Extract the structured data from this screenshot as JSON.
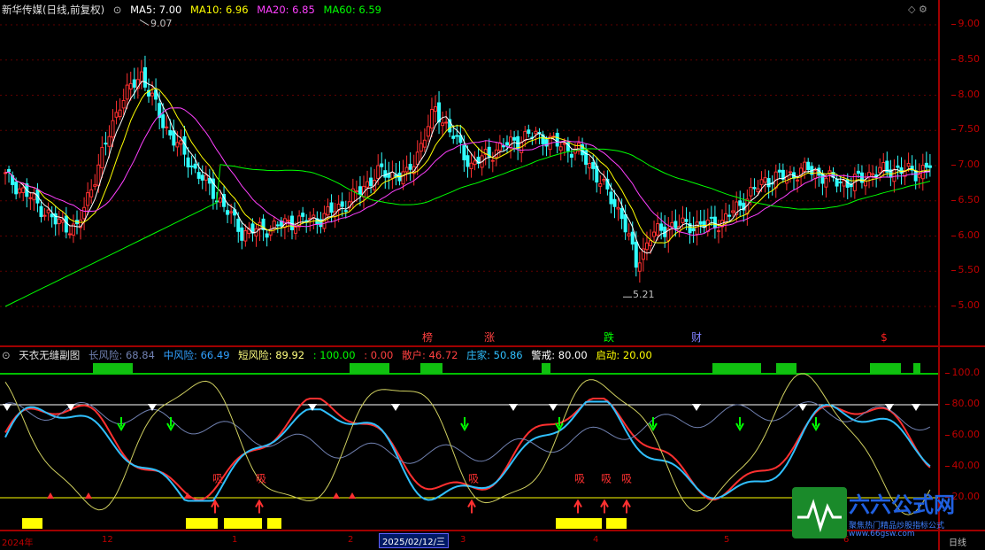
{
  "main": {
    "title": "新华传媒(日线,前复权)",
    "ma": [
      {
        "label": "MA5: 7.00",
        "color": "#ffffff"
      },
      {
        "label": "MA10: 6.96",
        "color": "#ffff00"
      },
      {
        "label": "MA20: 6.85",
        "color": "#ff40ff"
      },
      {
        "label": "MA60: 6.59",
        "color": "#00ff00"
      }
    ],
    "axis_ticks": [
      "9.00",
      "8.50",
      "8.00",
      "7.50",
      "7.00",
      "6.50",
      "6.00",
      "5.50",
      "5.00"
    ],
    "high_label": "9.07",
    "low_label": "5.21",
    "events": [
      {
        "text": "榜",
        "color": "#ff4040"
      },
      {
        "text": "涨",
        "color": "#ff4040"
      },
      {
        "text": "跌",
        "color": "#00ff00"
      },
      {
        "text": "财",
        "color": "#8080ff"
      },
      {
        "text": "$",
        "color": "#ff2020"
      }
    ]
  },
  "sub": {
    "title": "天衣无缝副图",
    "items": [
      {
        "label": "长风险: 68.84",
        "color": "#7080b0"
      },
      {
        "label": "中风险: 66.49",
        "color": "#30a0ff"
      },
      {
        "label": "短风险: 89.92",
        "color": "#ffff80"
      },
      {
        "label": ": 100.00",
        "color": "#00ff00"
      },
      {
        "label": ": 0.00",
        "color": "#ff4040"
      },
      {
        "label": "散户: 46.72",
        "color": "#ff4040"
      },
      {
        "label": "庄家: 50.86",
        "color": "#30c0ff"
      },
      {
        "label": "警戒: 80.00",
        "color": "#ffffff"
      },
      {
        "label": "启动: 20.00",
        "color": "#ffff00"
      }
    ],
    "axis_ticks": [
      "100.0",
      "80.00",
      "60.00",
      "40.00",
      "20.00"
    ],
    "buy_label": "吸"
  },
  "dates": {
    "labels": [
      "2024年",
      "12",
      "1",
      "2",
      "3",
      "4",
      "5",
      "6",
      "日线"
    ],
    "cursor": "2025/02/12/三"
  },
  "watermark": {
    "title": "六六公式网",
    "subtitle": "聚焦热门精品炒股指标公式",
    "url": "www.66gsw.com"
  },
  "chart_data": {
    "type": "candlestick",
    "ylim": [
      4.7,
      9.3
    ],
    "ma_values": {
      "MA5": 7.0,
      "MA10": 6.96,
      "MA20": 6.85,
      "MA60": 6.59
    },
    "price_high": 9.07,
    "price_low": 5.21,
    "sub_ylim": [
      0,
      110
    ],
    "sub_levels": {
      "警戒": 80,
      "启动": 20
    }
  }
}
